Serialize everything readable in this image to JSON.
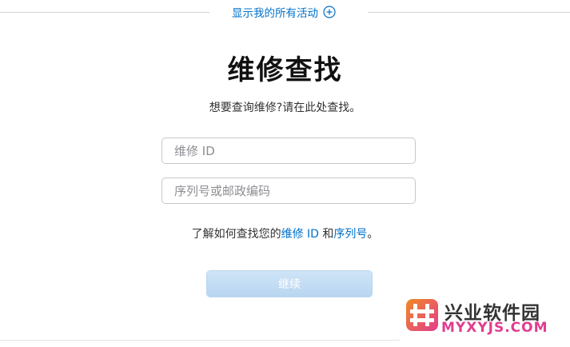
{
  "activity": {
    "link_label": "显示我的所有活动",
    "icon": "plus-circle-icon"
  },
  "main": {
    "title": "维修查找",
    "subtitle": "想要查询维修?请在此处查找。"
  },
  "form": {
    "repair_id_placeholder": "维修 ID",
    "repair_id_value": "",
    "serial_placeholder": "序列号或邮政编码",
    "serial_value": ""
  },
  "help": {
    "prefix": "了解如何查找您的",
    "repair_id_link": "维修 ID",
    "conjunction": " 和",
    "serial_link": "序列号",
    "suffix": "。"
  },
  "actions": {
    "continue_label": "继续",
    "continue_enabled": false
  },
  "watermark": {
    "title": "兴业软件园",
    "domain": "MYXYJS.COM"
  },
  "colors": {
    "link": "#0070c9",
    "button_disabled": "#b8d6f1",
    "watermark_pink": "#e23c8f",
    "watermark_orange": "#f08a24"
  }
}
